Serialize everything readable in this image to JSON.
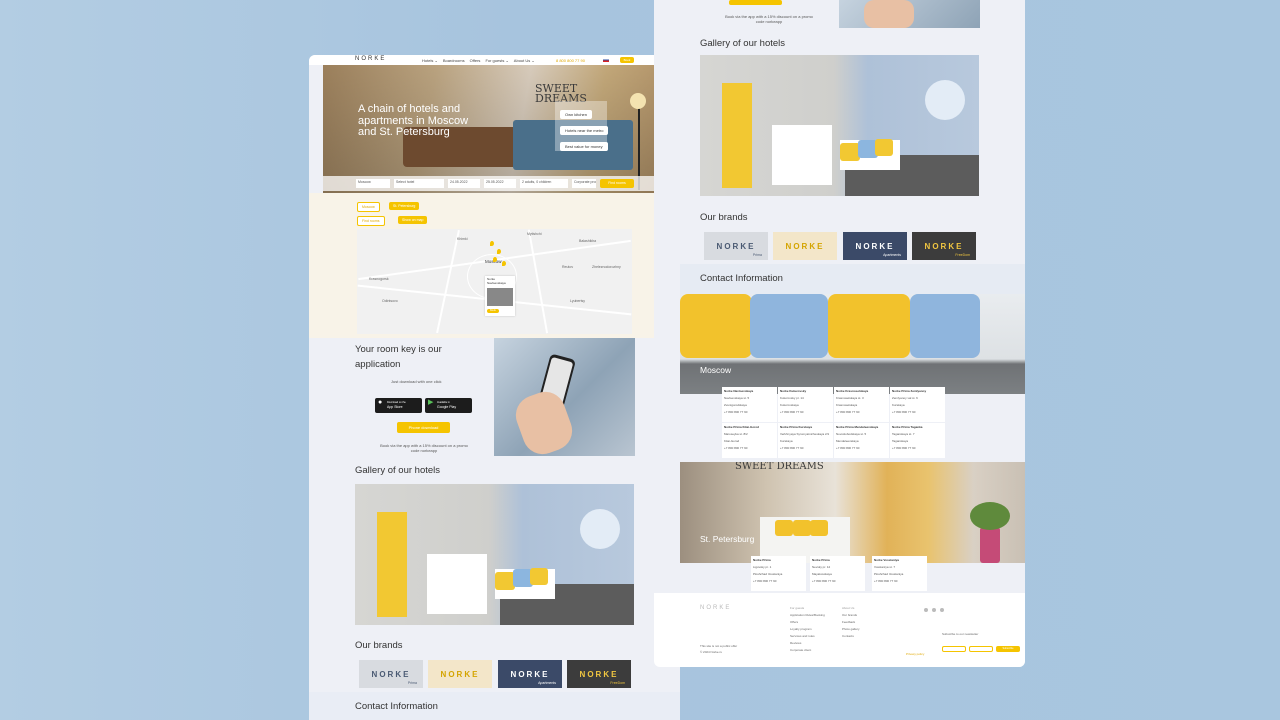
{
  "left": {
    "header": {
      "logo": "NORKE",
      "nav": [
        "Hotels ⌄",
        "Boardrooms",
        "Offers",
        "For guests ⌄",
        "About Us ⌄"
      ],
      "phone": "8 800 800 77 90",
      "book": "Book"
    },
    "hero": {
      "title": "A chain of hotels and apartments in Moscow and St. Petersburg",
      "wall_text": "SWEET DREAMS",
      "pills": [
        "Own kitchen",
        "Hotels near the metro",
        "Best value for money"
      ]
    },
    "search": {
      "fields": [
        "Moscow",
        "Select hotel",
        "24.05.2022",
        "25.05.2022",
        "2 adults, 0 children",
        "Corporate promo code"
      ],
      "submit": "Find rooms"
    },
    "tags": [
      "Moscow",
      "St. Petersburg",
      "Find rooms",
      "Show on map"
    ],
    "map_labels": [
      "Khimki",
      "Balashikha",
      "Moscow",
      "Lyubertsy",
      "Odintsovo",
      "Zheleznodorozhny",
      "Norke Navtsevskaya",
      "Krasnogorsk",
      "Reutov",
      "Mytishchi"
    ],
    "map_popup": {
      "title": "Norke Navtsevskaya",
      "button": "Book"
    },
    "app": {
      "title": "Your room key is our application",
      "subtitle": "Just download with one click",
      "appstore_small": "Download on the",
      "appstore": "App Store",
      "googleplay_small": "Available in",
      "googleplay": "Google Play",
      "download": "Phone download",
      "promo": "Book via the app with a 15% discount on a promo code norkeapp"
    },
    "gallery_title": "Gallery of our hotels",
    "brands_title": "Our brands",
    "brands": [
      {
        "name": "NORKE",
        "sub": "Prima"
      },
      {
        "name": "NORKE",
        "sub": ""
      },
      {
        "name": "NORKE",
        "sub": "Apartments"
      },
      {
        "name": "NORKE",
        "sub": "FreeDom"
      }
    ],
    "contact_title": "Contact Information"
  },
  "right": {
    "promo": "Book via the app with a 15% discount on a promo code norkeapp",
    "gallery_title": "Gallery of our hotels",
    "brands_title": "Our brands",
    "brands": [
      {
        "name": "NORKE",
        "sub": "Prima"
      },
      {
        "name": "NORKE",
        "sub": ""
      },
      {
        "name": "NORKE",
        "sub": "Apartments"
      },
      {
        "name": "NORKE",
        "sub": "FreeDom"
      }
    ],
    "contact_title": "Contact Information",
    "moscow": "Moscow",
    "spb": "St. Petersburg",
    "moscow_cards": [
      [
        "Norke Navtsevskaya",
        "Navtsevskaya st. 5",
        "Zvenigorodskaya",
        "+7 800 800 77 90"
      ],
      [
        "Norke Kutuzovsky",
        "Kutuzovsky pr. 14",
        "Kutuzovskaya",
        "+7 800 800 77 90"
      ],
      [
        "Norke Krasnoselskaya",
        "Krasnoselskaya st. 3",
        "Krasnoselskaya",
        "+7 800 800 77 90"
      ],
      [
        "Norke Prima Zemlyanoy",
        "Zemlyanoy val st. 6",
        "Kurskaya",
        "+7 800 800 77 90"
      ],
      [
        "Norke Prima Kitai-Gorod",
        "Maroseyka st. 8/2",
        "Kitai-Gorod",
        "+7 800 800 77 90"
      ],
      [
        "Norke Prima Kurskaya",
        "Verkhnyaya Syromyatnicheskaya 2/1",
        "Kurskaya",
        "+7 800 800 77 90"
      ],
      [
        "Norke Prima Mendeleevskaya",
        "Novoslobodskaya st. 5",
        "Mendeleevskaya",
        "+7 800 800 77 90"
      ],
      [
        "Norke Prima Taganka",
        "Taganskaya st. 7",
        "Taganskaya",
        "+7 800 800 77 90"
      ]
    ],
    "spb_cards": [
      [
        "Norke Prima",
        "Ligovsky pr. 1",
        "Ploshchad Vosstaniya",
        "+7 800 800 77 90"
      ],
      [
        "Norke Prima",
        "Nevsky pr. 12",
        "Mayakovskaya",
        "+7 800 800 77 90"
      ],
      [
        "Norke Vosstaniya",
        "Vosstaniya st. 7",
        "Ploshchad Vosstaniya",
        "+7 800 800 77 90"
      ]
    ],
    "footer": {
      "logo": "NORKE",
      "col1_title": "For guests",
      "col1": [
        "Application Rules/Booking",
        "Offers",
        "Loyalty program",
        "Services and rules",
        "Reviews",
        "Corporate client"
      ],
      "col2_title": "About Us",
      "col2": [
        "Our brands",
        "Feedback",
        "Photo gallery",
        "Contacts"
      ],
      "legal": [
        "This site is not a public offer",
        "© 2024 Norke.ru"
      ],
      "subscribe": "Subscribe to our newsletter",
      "sub_btn": "Subscribe",
      "link": "Privacy policy"
    }
  }
}
